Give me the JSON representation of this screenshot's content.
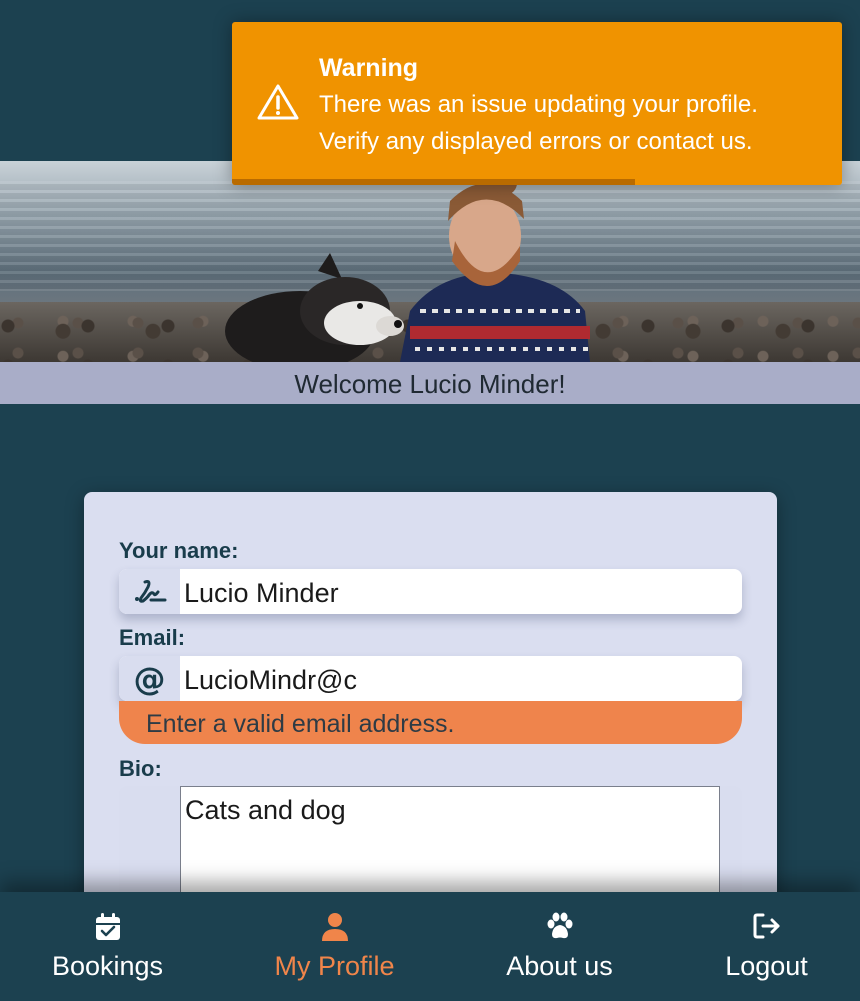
{
  "hero": {
    "welcome_text": "Welcome Lucio Minder!"
  },
  "form": {
    "name_label": "Your name:",
    "name_value": "Lucio Minder",
    "name_icon": "signature-icon",
    "email_label": "Email:",
    "email_value": "LucioMindr@c",
    "email_icon": "at-icon",
    "email_error": "Enter a valid email address.",
    "bio_label": "Bio:",
    "bio_value": "Cats and dog"
  },
  "nav": {
    "items": [
      {
        "label": "Bookings",
        "icon": "calendar-check-icon",
        "active": false
      },
      {
        "label": "My Profile",
        "icon": "user-icon",
        "active": true
      },
      {
        "label": "About us",
        "icon": "paw-icon",
        "active": false
      },
      {
        "label": "Logout",
        "icon": "logout-icon",
        "active": false
      }
    ],
    "active_color": "#f0854a"
  },
  "toast": {
    "title": "Warning",
    "line1": "There was an issue updating your profile.",
    "line2": "Verify any displayed errors or contact us.",
    "icon": "warning-icon",
    "color": "#f09300",
    "progress_remaining": 0.66
  }
}
